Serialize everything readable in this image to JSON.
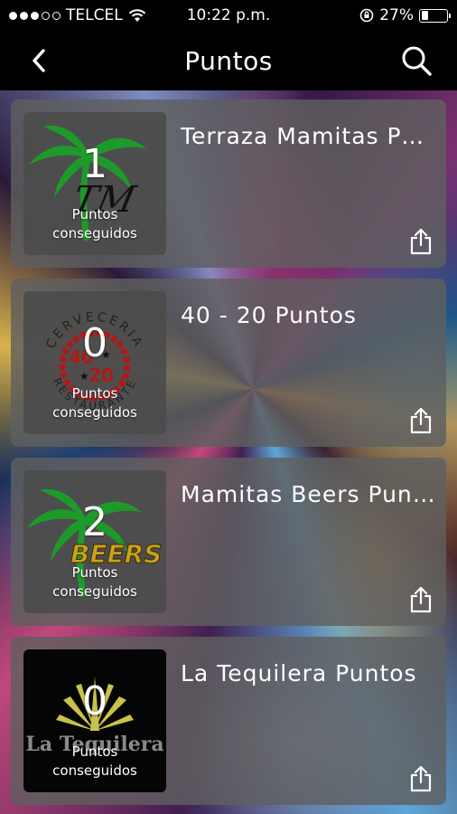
{
  "status_bar": {
    "carrier": "TELCEL",
    "time": "10:22 p.m.",
    "battery": "27%",
    "battery_level": 0.27,
    "signal_bars_filled": 3,
    "signal_bars_total": 5
  },
  "nav": {
    "title": "Puntos",
    "back_icon": "chevron-left-icon",
    "search_icon": "search-icon"
  },
  "cards": [
    {
      "title": "Terraza Mamitas Puntos",
      "points": "1",
      "points_label": "Puntos conseguidos",
      "logo": "palm-tm-logo"
    },
    {
      "title": "40 - 20 Puntos",
      "points": "0",
      "points_label": "Puntos conseguidos",
      "logo": "cerveceria-40-20-logo"
    },
    {
      "title": "Mamitas Beers Puntos",
      "points": "2",
      "points_label": "Puntos conseguidos",
      "logo": "palm-beers-logo"
    },
    {
      "title": "La Tequilera Puntos",
      "points": "0",
      "points_label": "Puntos conseguidos",
      "logo": "la-tequilera-logo"
    }
  ],
  "logo_text": {
    "cerveceria": "CERVECERIA",
    "num_top": "40",
    "num_bottom": "20",
    "restaurante": "RESTAURANTE",
    "beers": "BEERS",
    "tm": "TM",
    "tequilera": "La Tequilera"
  },
  "colors": {
    "palm_green": "#1e9a2a",
    "seal_red": "#b01818",
    "beers_yellow": "#c9a21a",
    "agave_yellow": "#c8c24a"
  },
  "share_icon": "share-icon"
}
